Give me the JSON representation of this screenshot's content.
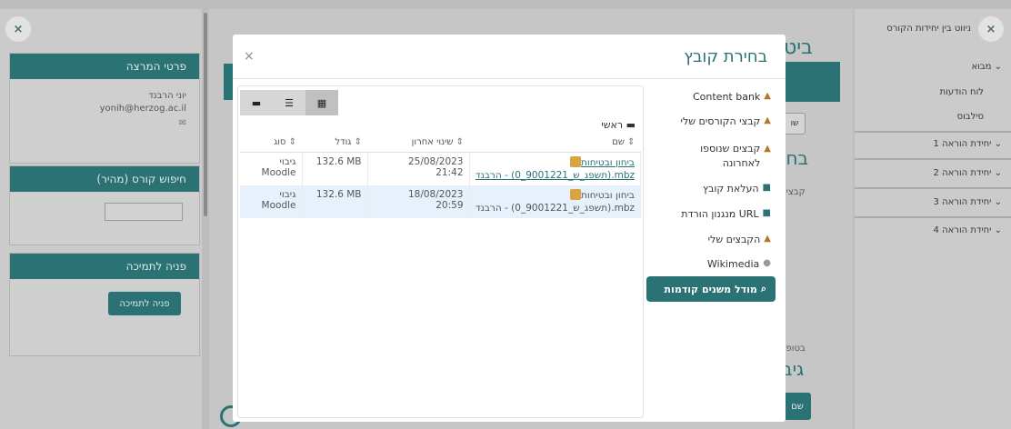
{
  "left": {
    "lecturer_block": {
      "title": "פרטי המרצה",
      "name": "יוני הרבנד",
      "email": "yonih@herzog.ac.il"
    },
    "search_block": {
      "title": "חיפוש קורס (מהיר)"
    },
    "support_block": {
      "title": "פניה לתמיכה",
      "button": "פניה לתמיכה"
    }
  },
  "right_nav": {
    "title": "ניווט בין יחידות הקורס",
    "section_intro": "מבוא",
    "items": [
      "לוח הודעות",
      "סילבוס"
    ],
    "units": [
      "יחידת הוראה 1",
      "יחידת הוראה 2",
      "יחידת הוראה 3",
      "יחידת הוראה 4"
    ]
  },
  "background": {
    "heading_top": "ביט",
    "heading_mid": "בחי",
    "small_text": "קבצים",
    "input_frag": "שו",
    "bottom_small": "בטופס",
    "bottom_heading": "גיב",
    "bottom_btn": "שם"
  },
  "modal": {
    "title": "בחירת קובץ",
    "close": "×",
    "repositories": [
      {
        "label": "Content bank",
        "icon": "content-bank-icon"
      },
      {
        "label": "קבצי הקורסים שלי",
        "icon": "course-files-icon"
      },
      {
        "label": "קבצים שנוספו לאחרונה",
        "icon": "recent-files-icon"
      },
      {
        "label": "העלאת קובץ",
        "icon": "upload-icon"
      },
      {
        "label": "מנגנון הורדת URL",
        "icon": "url-download-icon"
      },
      {
        "label": "הקבצים שלי",
        "icon": "private-files-icon"
      },
      {
        "label": "Wikimedia",
        "icon": "wikimedia-icon"
      }
    ],
    "active_repository": "מודל משנים קודמות",
    "breadcrumb": "ראשי",
    "columns": {
      "name": "שם",
      "modified": "שינוי אחרון",
      "size": "גודל",
      "type": "סוג"
    },
    "files": [
      {
        "name": "ביחון ובטיחות (תשפג_ש_9001221_0) - הרבנד.mbz",
        "date": "25/08/2023",
        "time": "21:42",
        "size": "132.6 MB",
        "type": "גיבוי Moodle"
      },
      {
        "name": "ביחון ובטיחות (תשפג_ש_9001221_0) - הרבנד.mbz",
        "date": "18/08/2023",
        "time": "20:59",
        "size": "132.6 MB",
        "type": "גיבוי Moodle"
      }
    ]
  }
}
